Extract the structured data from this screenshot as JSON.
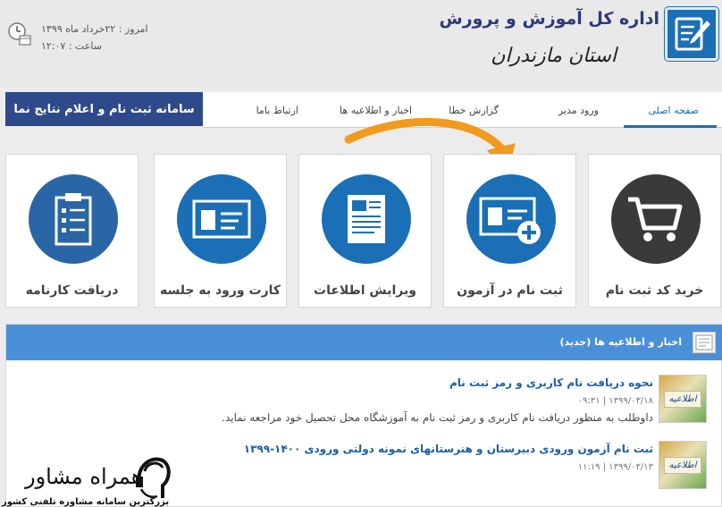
{
  "header": {
    "org_title": "اداره کل آموزش و پرورش",
    "org_subtitle": "استان مازندران",
    "date_text": "امروز : ۲۲خرداد ماه ۱۳۹۹",
    "time_text": "ساعت : ۱۲:۰۷"
  },
  "nav": {
    "brand": "سامانه ثبت نام و اعلام نتایج نما",
    "items": [
      {
        "label": "صفحه اصلی"
      },
      {
        "label": "ورود مدیر"
      },
      {
        "label": "گزارش خطا"
      },
      {
        "label": "اخبار و اطلاعیه ها"
      },
      {
        "label": "ارتباط باما"
      }
    ]
  },
  "cards": [
    {
      "label": "خرید کد ثبت نام",
      "icon": "shopping-cart-icon"
    },
    {
      "label": "ثبت نام در آزمون",
      "icon": "id-card-add-icon"
    },
    {
      "label": "ویرایش اطلاعات",
      "icon": "document-edit-icon"
    },
    {
      "label": "کارت ورود به جلسه",
      "icon": "id-card-icon"
    },
    {
      "label": "دریافت کارنامه",
      "icon": "clipboard-icon"
    }
  ],
  "news": {
    "header_title": "اخبار و اطلاعیه ها (جدید)",
    "thumb_text": "اطلاعیه",
    "items": [
      {
        "title": "نحوه دریافت نام کاربری و رمز ثبت نام",
        "meta": "۱۳۹۹/۰۳/۱۸ | ۰۹:۳۱",
        "desc": "داوطلب به منظور دریافت نام کاربری و رمز ثبت نام به آموزشگاه محل تحصیل خود مراجعه نماید."
      },
      {
        "title": "ثبت نام آزمون ورودی دبیرستان و هنرستانهای نمونه دولتی ورودی ۱۴۰۰-۱۳۹۹",
        "meta": "۱۳۹۹/۰۳/۱۳ | ۱۱:۱۹",
        "desc": ""
      }
    ]
  },
  "watermark": {
    "name": "همراه مشاور",
    "slogan": "بزرگترین سامانه مشاوره تلفنی کشور"
  },
  "colors": {
    "brand_blue": "#1a6fb6",
    "nav_brand_bg": "#2f4a8a",
    "news_header": "#4a90d9",
    "arrow_orange": "#f29a1d"
  }
}
